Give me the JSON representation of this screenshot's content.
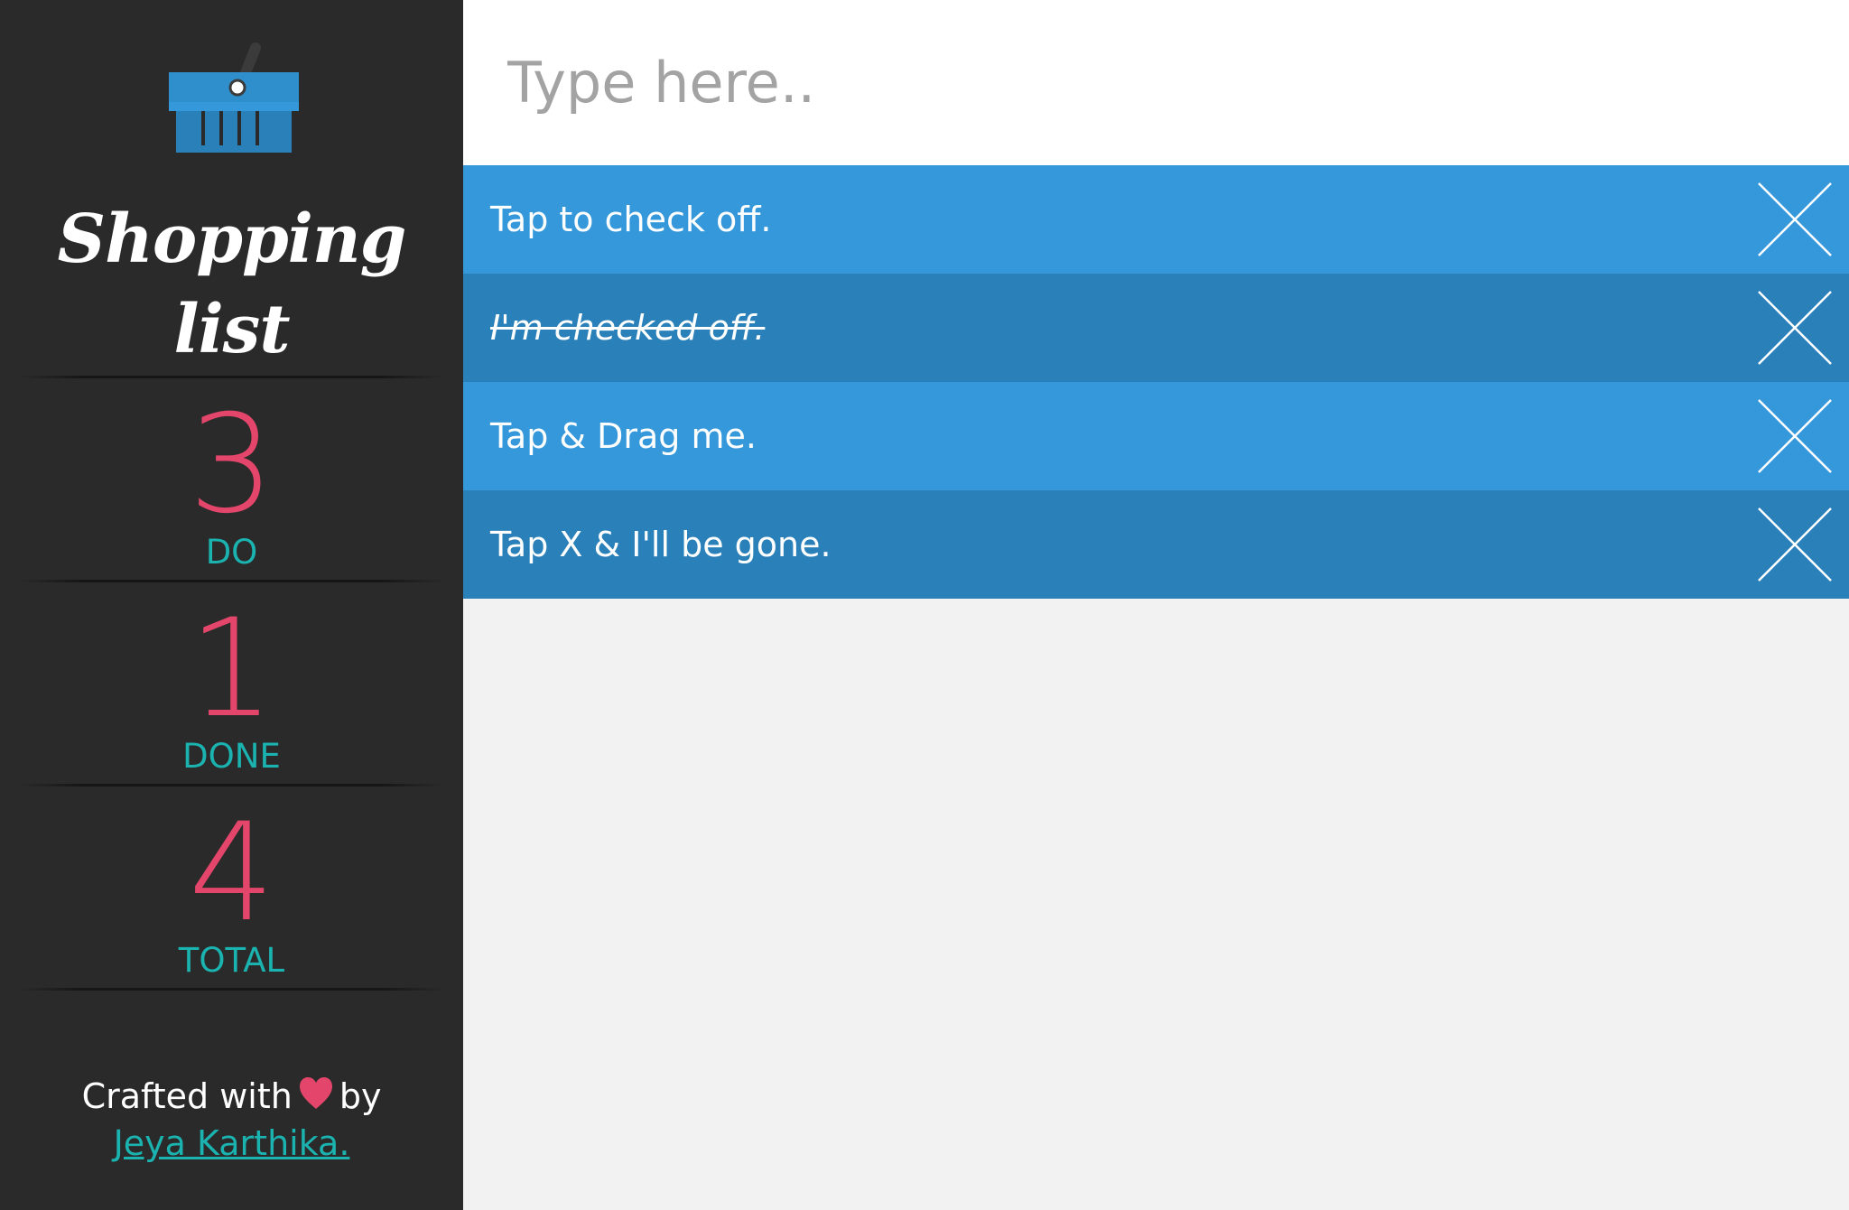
{
  "sidebar": {
    "title": "Shopping list",
    "stats": [
      {
        "number": "3",
        "label": "DO"
      },
      {
        "number": "1",
        "label": "DONE"
      },
      {
        "number": "4",
        "label": "TOTAL"
      }
    ],
    "credits": {
      "prefix": "Crafted with",
      "suffix": "by",
      "author": "Jeya Karthika."
    }
  },
  "input": {
    "placeholder": "Type here.."
  },
  "items": [
    {
      "text": "Tap to check off.",
      "checked": false
    },
    {
      "text": "I'm checked off.",
      "checked": true
    },
    {
      "text": "Tap & Drag me.",
      "checked": false
    },
    {
      "text": "Tap X & I'll be gone.",
      "checked": false
    }
  ],
  "colors": {
    "sidebar_bg": "#2a2a2a",
    "accent_pink": "#e3466a",
    "accent_teal": "#1bb3b0",
    "item_light": "#3598db",
    "item_dark": "#2a80b9",
    "content_bg": "#f2f2f2"
  },
  "icons": {
    "logo": "shopping-basket-icon",
    "heart": "heart-icon",
    "delete": "close-icon"
  }
}
